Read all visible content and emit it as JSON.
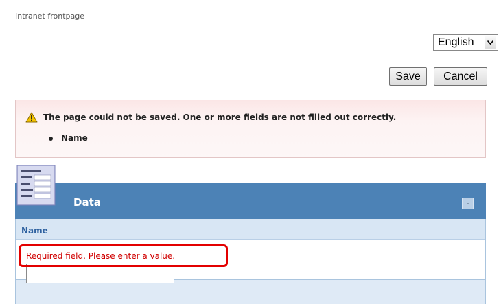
{
  "breadcrumb": "Intranet frontpage",
  "language_select": {
    "value": "English",
    "arrow_icon": "chevron-down-icon"
  },
  "actions": {
    "save_label": "Save",
    "cancel_label": "Cancel"
  },
  "error": {
    "message": "The page could not be saved. One or more fields are not filled out correctly.",
    "fields": [
      "Name"
    ],
    "icon": "warning-icon"
  },
  "section": {
    "title": "Data",
    "collapse_label": "-",
    "icon": "document-icon",
    "field_label": "Name",
    "validation_message": "Required field. Please enter a value.",
    "name_value": ""
  },
  "colors": {
    "header_blue": "#4c82b6",
    "field_row": "#d8e6f4",
    "error_text": "#d00000",
    "highlight": "#e30000"
  }
}
